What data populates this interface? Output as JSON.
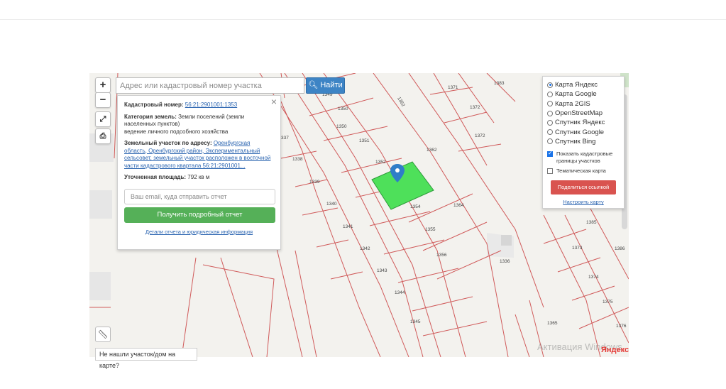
{
  "map": {
    "zoom_in": "+",
    "zoom_out": "−",
    "parcel_numbers": [
      "1349",
      "1350",
      "1351",
      "1352",
      "1362",
      "1371",
      "1372",
      "1373",
      "1383",
      "1338",
      "1339",
      "1340",
      "1341",
      "1342",
      "1343",
      "1344",
      "1345",
      "1354",
      "1355",
      "1356",
      "1364",
      "1336",
      "1385",
      "1386",
      "1373",
      "1374",
      "1375",
      "1376",
      "1365",
      "1350",
      "1372"
    ],
    "map_logo": "Яндекс",
    "watermark": "Активация Windows"
  },
  "search": {
    "placeholder": "Адрес или кадастровый номер участка",
    "button_label": "Найти"
  },
  "info_panel": {
    "cadastral_label": "Кадастровый номер:",
    "cadastral_value": "56:21:2901001:1353",
    "category_label": "Категория земель:",
    "category_value": "Земли поселений (земли населенных пунктов)",
    "use_value": "ведение личного подсобного хозяйства",
    "address_label": "Земельный участок по адресу:",
    "address_value": "Оренбургская область, Оренбургский район, Экспериментальный сельсовет, земельный участок расположен в восточной части кадастрового квартала 56:21:2901001...",
    "area_label": "Уточненная площадь:",
    "area_value": "792 кв м",
    "email_placeholder": "Ваш email, куда отправить отчет",
    "report_button": "Получить подробный отчет",
    "details_link": "Детали отчета и юридическая информация"
  },
  "layers": {
    "options": [
      "Карта Яндекс",
      "Карта Google",
      "Карта 2GIS",
      "OpenStreetMap",
      "Спутник Яндекс",
      "Спутник Google",
      "Спутник Bing"
    ],
    "selected": "Карта Яндекс",
    "show_boundaries": "Показать кадастровые границы участков",
    "thematic_map": "Тематическая карта",
    "share_button": "Поделиться ссылкой",
    "setup_link": "Настроить карту"
  },
  "bottom": {
    "not_found": "Не нашли участок/дом на карте?"
  },
  "colors": {
    "accent_blue": "#3d84c5",
    "report_green": "#55b058",
    "share_red": "#d9534f",
    "parcel_line": "#d05a5a",
    "selected_parcel": "#4ee05a"
  }
}
